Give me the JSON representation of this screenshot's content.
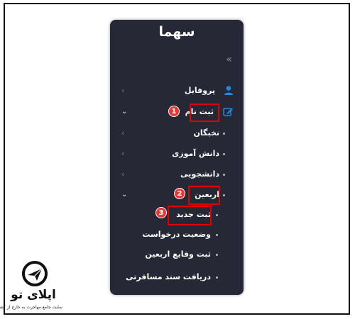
{
  "app": {
    "title": "سهما"
  },
  "menu": {
    "items": [
      {
        "label": "پروفایل",
        "icon": "user-icon",
        "chevron": "left"
      },
      {
        "label": "ثبت نام",
        "icon": "edit-icon",
        "chevron": "down",
        "expanded": true
      },
      {
        "label": "نخبگان",
        "chevron": "left"
      },
      {
        "label": "دانش آموزی",
        "chevron": "left"
      },
      {
        "label": "دانشجویی",
        "chevron": "left"
      },
      {
        "label": "اربعین",
        "chevron": "down",
        "expanded": true
      },
      {
        "label": "ثبت جدید"
      },
      {
        "label": "وضعیت درخواست"
      },
      {
        "label": "ثبت وقایع اربعین"
      },
      {
        "label": "دریافت سند مسافرتی"
      }
    ]
  },
  "annotations": [
    "1",
    "2",
    "3"
  ],
  "brand": {
    "name": "اپلای تو",
    "tagline": "سایت جامع مهاجرت به خارج از کشور"
  },
  "colors": {
    "panel": "#262836",
    "accent": "#1e88e5",
    "highlight": "#e00000",
    "marker": "#e53935"
  }
}
